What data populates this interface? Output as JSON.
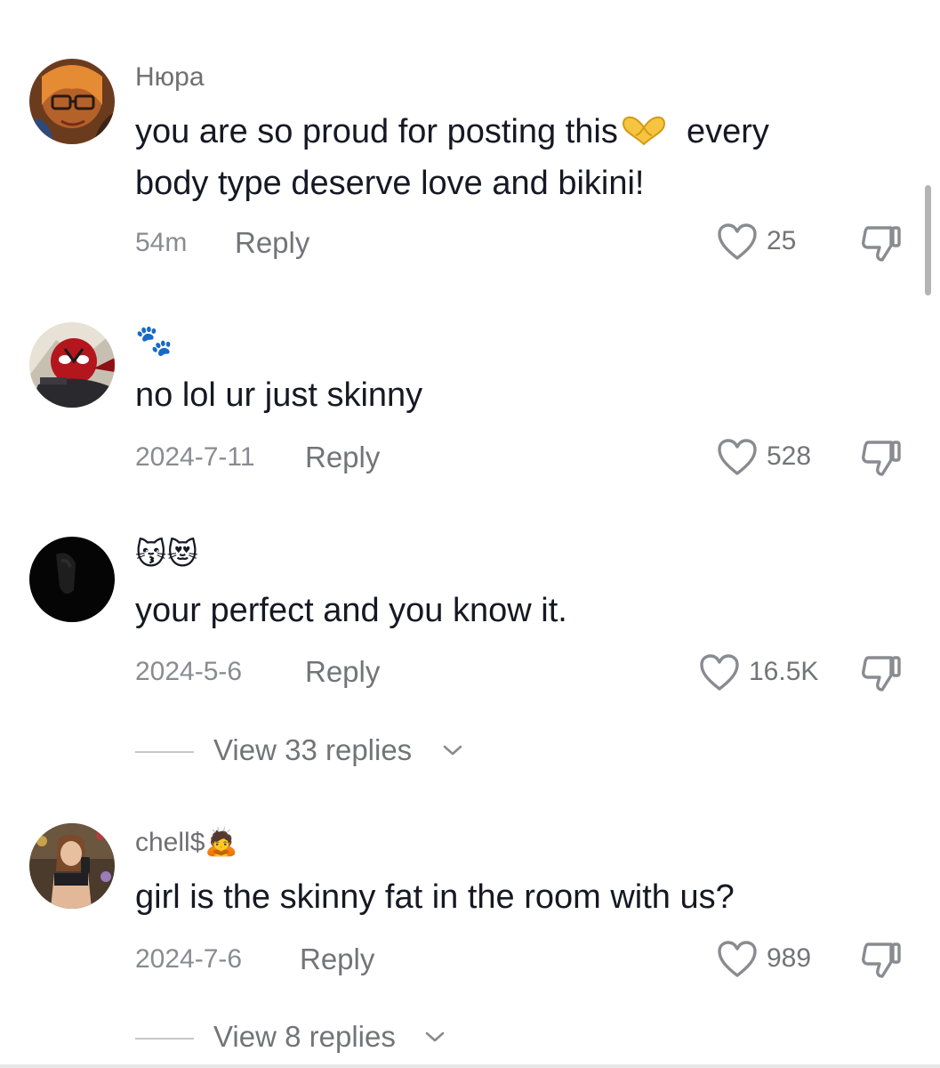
{
  "colors": {
    "primary_text": "#161823",
    "secondary_text": "#737479",
    "date_text": "#8a8b91",
    "icon_stroke": "#8a8b91",
    "emoji_heart_hands": "#f5b400"
  },
  "comments": [
    {
      "username": "Нюра",
      "text_line1": "you are so proud for posting this",
      "text_line1_emoji": "heart-hands-icon",
      "text_line1_after": "every",
      "text_line2": "body type deserve love and bikini!",
      "date": "54m",
      "reply_label": "Reply",
      "likes": "25"
    },
    {
      "username_emoji": "🐾",
      "text": "no lol ur just skinny",
      "date": "2024-7-11",
      "reply_label": "Reply",
      "likes": "528"
    },
    {
      "username_emoji": "😽😻",
      "text": "your perfect and you know it.",
      "date": "2024-5-6",
      "reply_label": "Reply",
      "likes": "16.5K",
      "view_replies": "View 33 replies"
    },
    {
      "username": "chell$",
      "username_emoji": "🙇",
      "text": "girl is the skinny fat in the room with us?",
      "date": "2024-7-6",
      "reply_label": "Reply",
      "likes": "989",
      "view_replies": "View 8 replies"
    }
  ]
}
